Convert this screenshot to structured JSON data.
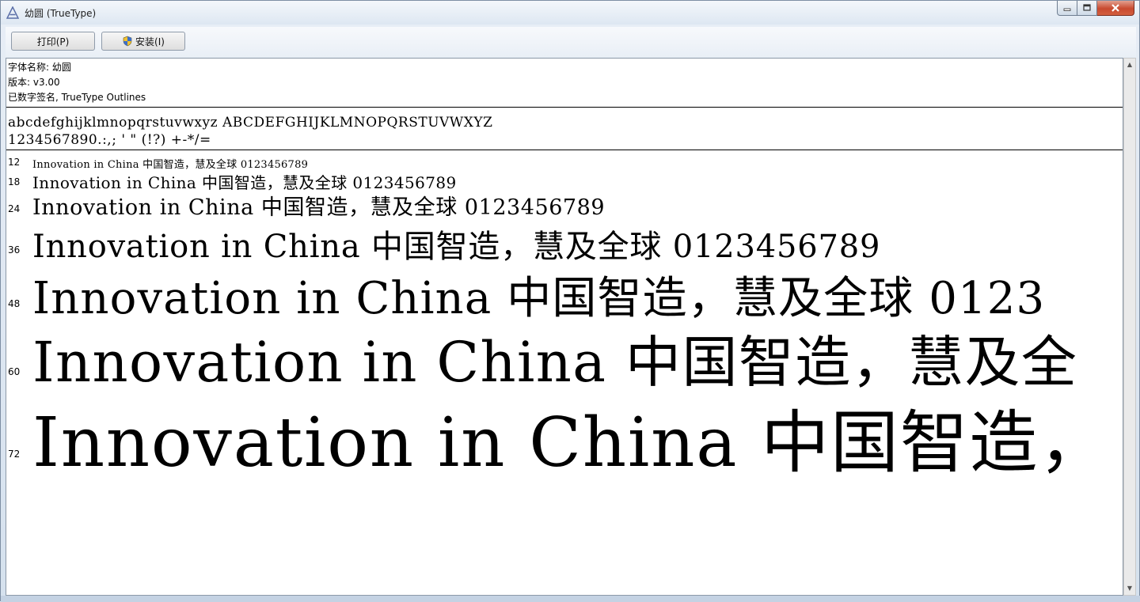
{
  "window": {
    "title": "幼圆 (TrueType)"
  },
  "toolbar": {
    "print_label": "打印(P)",
    "install_label": "安装(I)"
  },
  "info": {
    "font_name": "字体名称: 幼圆",
    "version": "版本: v3.00",
    "signature": "已数字签名, TrueType Outlines"
  },
  "charset": {
    "line1": "abcdefghijklmnopqrstuvwxyz ABCDEFGHIJKLMNOPQRSTUVWXYZ",
    "line2": "1234567890.:,; ' \" (!?) +-*/="
  },
  "samples": [
    {
      "size": "12",
      "text": "Innovation in China 中国智造，慧及全球 0123456789"
    },
    {
      "size": "18",
      "text": "Innovation in China 中国智造，慧及全球 0123456789"
    },
    {
      "size": "24",
      "text": "Innovation in China 中国智造，慧及全球 0123456789"
    },
    {
      "size": "36",
      "text": "Innovation in China 中国智造，慧及全球 0123456789"
    },
    {
      "size": "48",
      "text": "Innovation in China 中国智造，慧及全球 0123"
    },
    {
      "size": "60",
      "text": "Innovation in China 中国智造，慧及全"
    },
    {
      "size": "72",
      "text": "Innovation in China 中国智造，"
    }
  ],
  "icons": {
    "app": "font-viewer-icon",
    "install": "shield-icon",
    "minimize": "minimize-icon",
    "maximize": "maximize-icon",
    "close": "close-icon"
  }
}
